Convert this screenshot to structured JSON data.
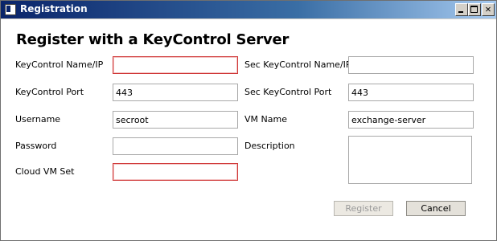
{
  "window": {
    "title": "Registration",
    "app_icon": "window-app-icon",
    "controls": {
      "minimize": "minimize-icon",
      "maximize": "maximize-icon",
      "close": "✕"
    }
  },
  "form": {
    "heading": "Register with a KeyControl Server",
    "left": [
      {
        "label": "KeyControl Name/IP",
        "value": "",
        "invalid": true
      },
      {
        "label": "KeyControl Port",
        "value": "443",
        "invalid": false
      },
      {
        "label": "Username",
        "value": "secroot",
        "invalid": false
      },
      {
        "label": "Password",
        "value": "",
        "invalid": false
      },
      {
        "label": "Cloud VM Set",
        "value": "",
        "invalid": true
      }
    ],
    "right": [
      {
        "label": "Sec KeyControl Name/IP",
        "value": ""
      },
      {
        "label": "Sec KeyControl Port",
        "value": "443"
      },
      {
        "label": "VM Name",
        "value": "exchange-server"
      },
      {
        "label": "Description",
        "value": ""
      }
    ],
    "buttons": {
      "register": "Register",
      "cancel": "Cancel",
      "register_enabled": false
    }
  },
  "colors": {
    "title_gradient_start": "#0a246a",
    "title_gradient_end": "#a6caf0",
    "invalid_border": "#d03a3a"
  }
}
